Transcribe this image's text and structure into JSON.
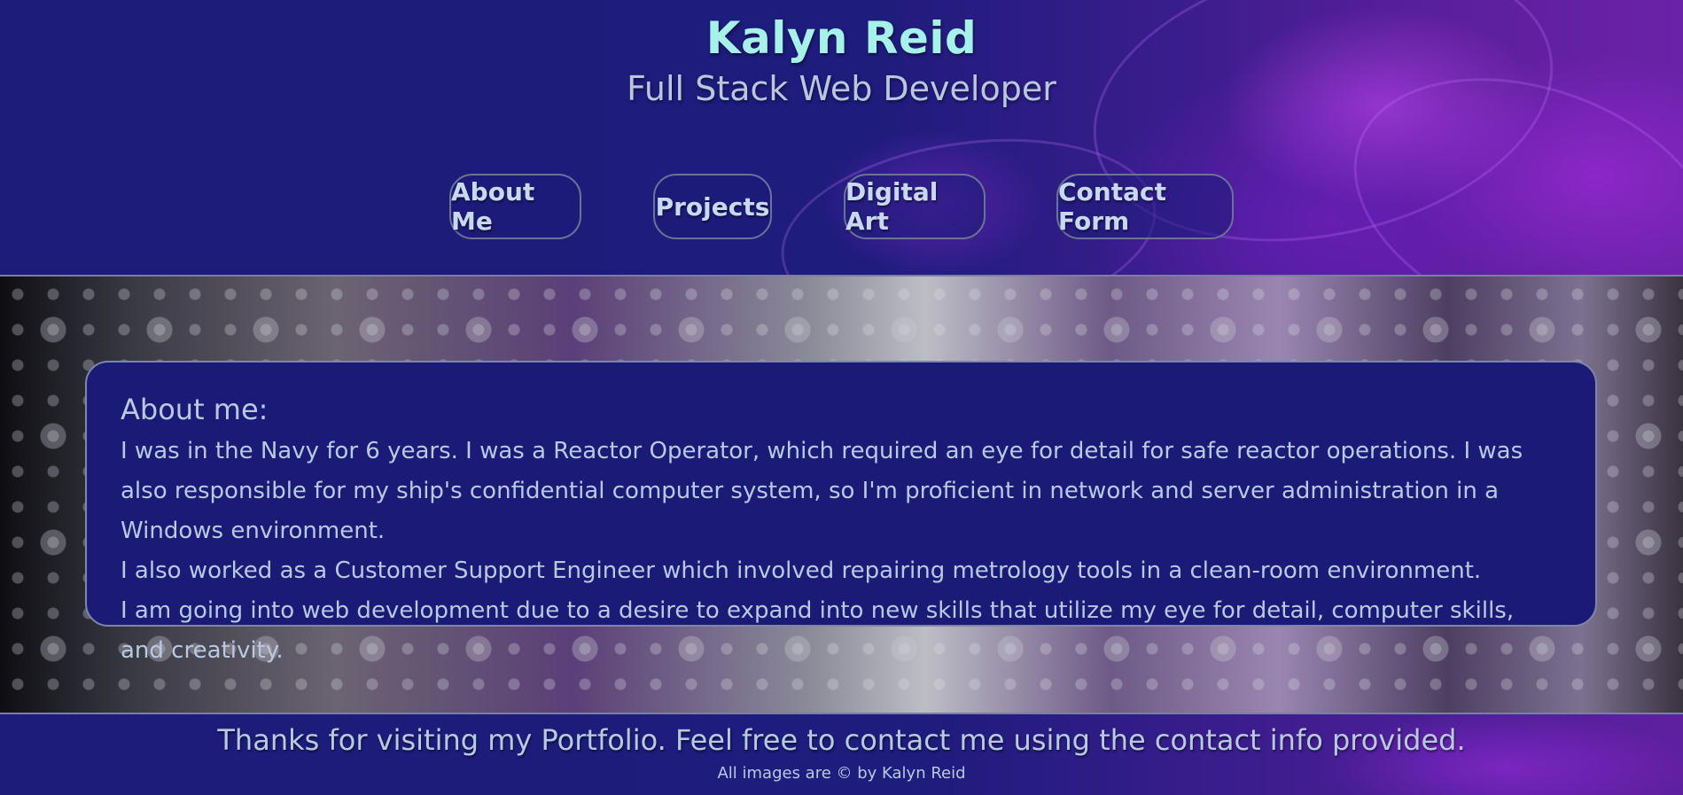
{
  "header": {
    "name": "Kalyn Reid",
    "subtitle": "Full Stack Web Developer"
  },
  "nav": {
    "items": [
      {
        "label": "About Me"
      },
      {
        "label": "Projects"
      },
      {
        "label": "Digital Art"
      },
      {
        "label": "Contact Form"
      }
    ]
  },
  "about": {
    "heading": "About me:",
    "line1": "I was in the Navy for 6 years. I was a Reactor Operator, which required an eye for detail for safe reactor operations. I was also responsible for my ship's confidential computer system, so I'm proficient in network and server administration in a Windows environment.",
    "line2": "I also worked as a Customer Support Engineer which involved repairing metrology tools in a clean-room environment.",
    "line3": "I am going into web development due to a desire to expand into new skills that utilize my eye for detail, computer skills, and creativity."
  },
  "footer": {
    "thanks": "Thanks for visiting my Portfolio. Feel free to contact me using the contact info provided.",
    "copyright": "All images are © by Kalyn Reid"
  }
}
